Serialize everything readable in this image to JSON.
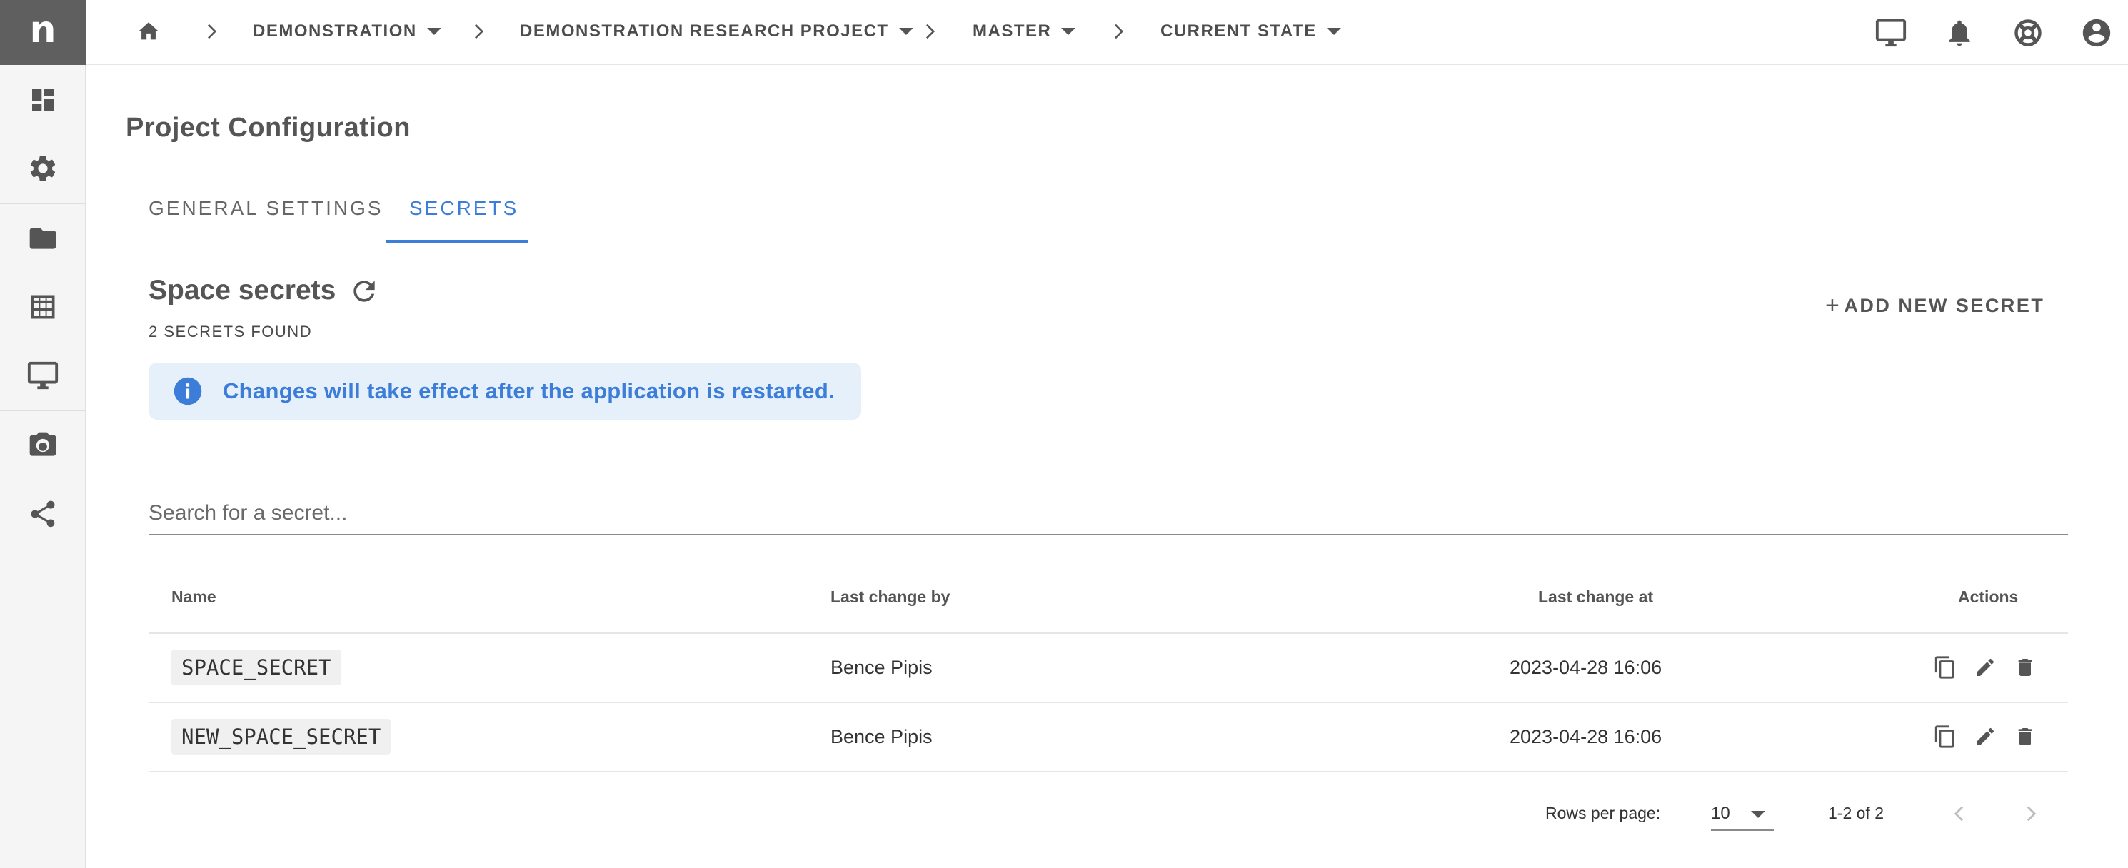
{
  "logo_letter": "n",
  "breadcrumbs": [
    {
      "label": "DEMONSTRATION"
    },
    {
      "label": "DEMONSTRATION RESEARCH PROJECT"
    },
    {
      "label": "MASTER"
    },
    {
      "label": "CURRENT STATE"
    }
  ],
  "sidebar_icons": [
    "dashboard-icon",
    "gear-icon",
    "folder-icon",
    "table-icon",
    "monitor-icon",
    "camera-icon",
    "share-icon"
  ],
  "top_icons": [
    "monitor-icon",
    "bell-icon",
    "lifebuoy-icon",
    "account-icon"
  ],
  "page": {
    "title": "Project Configuration",
    "tabs": [
      {
        "label": "GENERAL SETTINGS",
        "active": false
      },
      {
        "label": "SECRETS",
        "active": true
      }
    ]
  },
  "secrets": {
    "section_title": "Space secrets",
    "count_text": "2 SECRETS FOUND",
    "add_label": "ADD NEW SECRET",
    "add_plus": "+",
    "alert": "Changes will take effect after the application is restarted.",
    "search_placeholder": "Search for a secret...",
    "columns": {
      "name": "Name",
      "changed_by": "Last change by",
      "changed_at": "Last change at",
      "actions": "Actions"
    },
    "rows": [
      {
        "name": "SPACE_SECRET",
        "changed_by": "Bence Pipis",
        "changed_at": "2023-04-28 16:06"
      },
      {
        "name": "NEW_SPACE_SECRET",
        "changed_by": "Bence Pipis",
        "changed_at": "2023-04-28 16:06"
      }
    ]
  },
  "pagination": {
    "rows_per_page_label": "Rows per page:",
    "rows_per_page": "10",
    "range": "1-2 of 2"
  },
  "colors": {
    "accent": "#3b7dd8",
    "alert_bg": "#e5f0fb",
    "sidebar_bg": "#f5f5f5",
    "logo_bg": "#5f5f5f"
  }
}
